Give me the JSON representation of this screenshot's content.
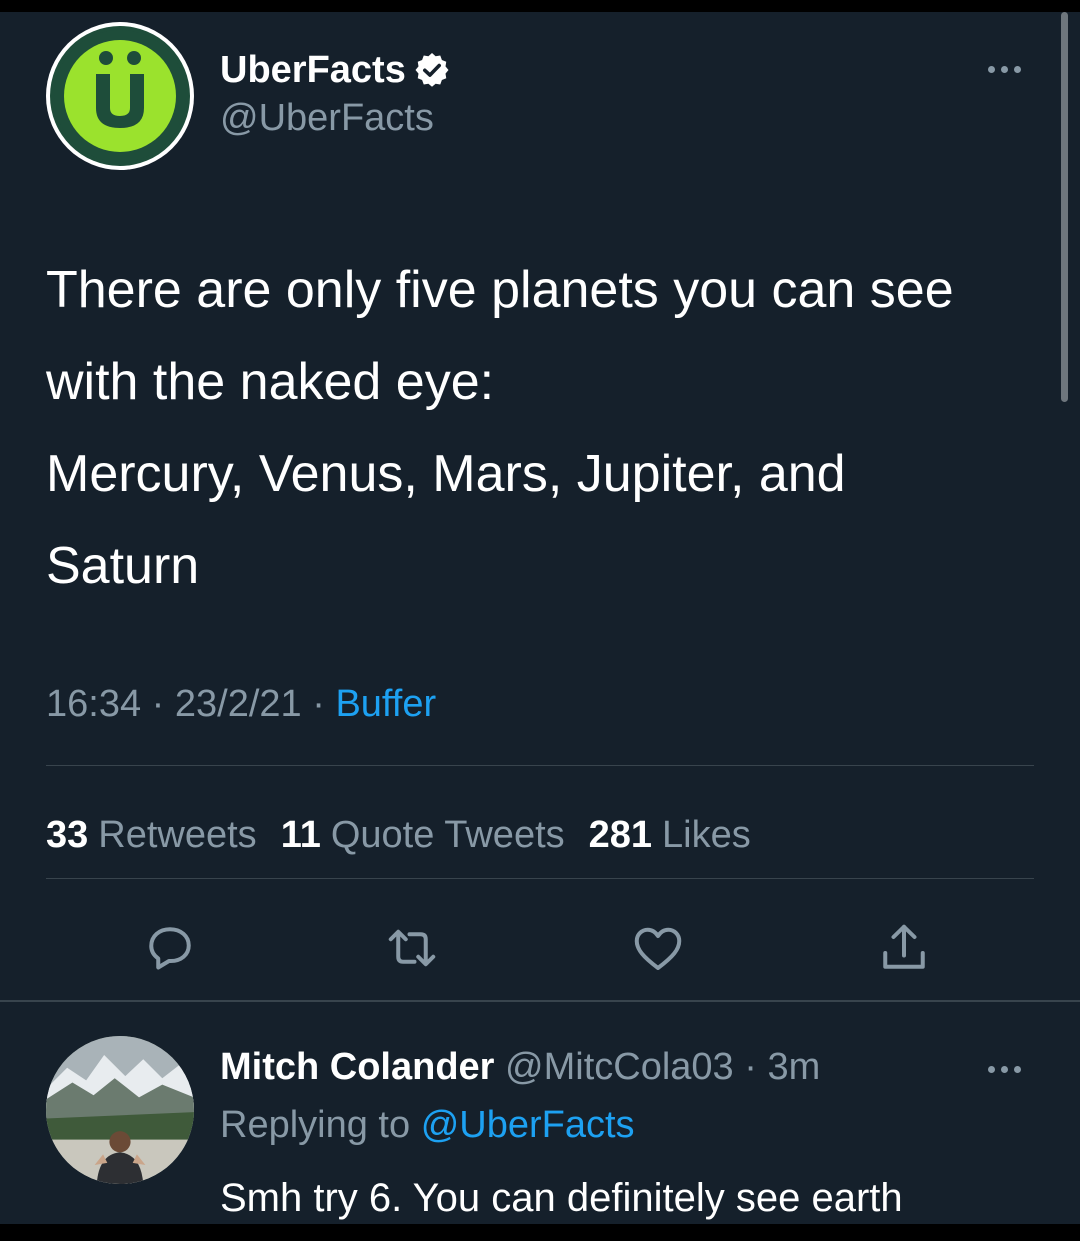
{
  "tweet": {
    "avatar_icon": "uberfacts-logo-icon",
    "display_name": "UberFacts",
    "handle": "@UberFacts",
    "text_line1": "There are only five planets you can see with the naked eye:",
    "text_line2": "Mercury, Venus, Mars, Jupiter, and Saturn",
    "time": "16:34",
    "separator": "·",
    "date": "23/2/21",
    "source": "Buffer",
    "stats": {
      "retweets_count": "33",
      "retweets_label": "Retweets",
      "quotes_count": "11",
      "quotes_label": "Quote Tweets",
      "likes_count": "281",
      "likes_label": "Likes"
    }
  },
  "reply": {
    "display_name": "Mitch Colander",
    "handle": "@MitcCola03",
    "separator": "·",
    "time_ago": "3m",
    "replying_prefix": "Replying to",
    "replying_to": "@UberFacts",
    "text": "Smh try 6. You can definitely see earth"
  },
  "colors": {
    "background": "#15202b",
    "text": "#ffffff",
    "secondary_text": "#8899a6",
    "accent": "#1da1f2",
    "divider": "#38444d",
    "logo_green": "#9be22d"
  }
}
